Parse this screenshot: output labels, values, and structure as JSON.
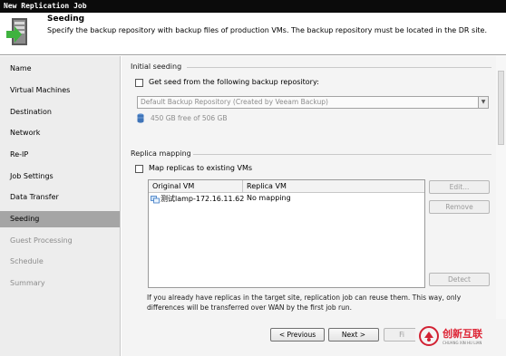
{
  "window": {
    "title": "New Replication Job"
  },
  "header": {
    "title": "Seeding",
    "description": "Specify the backup repository with backup files of production VMs. The backup repository must be located in the DR site."
  },
  "sidebar": {
    "items": [
      {
        "label": "Name",
        "state": "normal"
      },
      {
        "label": "Virtual Machines",
        "state": "normal"
      },
      {
        "label": "Destination",
        "state": "normal"
      },
      {
        "label": "Network",
        "state": "normal"
      },
      {
        "label": "Re-IP",
        "state": "normal"
      },
      {
        "label": "Job Settings",
        "state": "normal"
      },
      {
        "label": "Data Transfer",
        "state": "normal"
      },
      {
        "label": "Seeding",
        "state": "active"
      },
      {
        "label": "Guest Processing",
        "state": "disabled"
      },
      {
        "label": "Schedule",
        "state": "disabled"
      },
      {
        "label": "Summary",
        "state": "disabled"
      }
    ]
  },
  "initial_seeding": {
    "section_label": "Initial seeding",
    "checkbox_label": "Get seed from the following backup repository:",
    "checked": false,
    "repository_value": "Default Backup Repository (Created by Veeam Backup)",
    "free_space": "450 GB free of 506 GB"
  },
  "replica_mapping": {
    "section_label": "Replica mapping",
    "checkbox_label": "Map replicas to existing VMs",
    "checked": false,
    "columns": [
      "Original VM",
      "Replica VM"
    ],
    "rows": [
      {
        "original": "测试lamp-172.16.11.62",
        "replica": "No mapping"
      }
    ],
    "buttons": {
      "edit": "Edit...",
      "remove": "Remove",
      "detect": "Detect"
    },
    "info_text": "If you already have replicas in the target site, replication job can reuse them. This way, only differences will be transferred over WAN by the first job run."
  },
  "footer": {
    "previous": "< Previous",
    "next": "Next >",
    "finish": "Fi"
  },
  "watermark": {
    "text": "创新互联",
    "subtext": "CHUANG XIN HU LIAN"
  },
  "colors": {
    "active_sidebar": "#a5a5a5",
    "header_bar": "#0b0b0b",
    "watermark": "#d22233"
  },
  "icons": {
    "header": "replication-job-icon",
    "repository": "database-icon",
    "vm": "vm-icon"
  }
}
